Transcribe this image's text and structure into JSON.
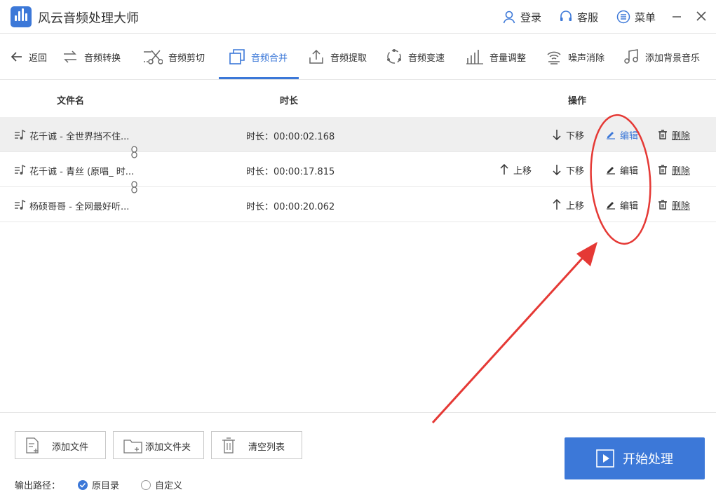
{
  "app": {
    "title": "风云音频处理大师"
  },
  "top_actions": {
    "login": "登录",
    "service": "客服",
    "menu": "菜单"
  },
  "nav": {
    "back": "返回",
    "items": [
      "音频转换",
      "音频剪切",
      "音频合并",
      "音频提取",
      "音频变速",
      "音量调整",
      "噪声消除",
      "添加背景音乐"
    ],
    "active": "音频合并"
  },
  "table": {
    "headers": {
      "filename": "文件名",
      "duration": "时长",
      "operation": "操作"
    },
    "rows": [
      {
        "name": "花千诚 - 全世界挡不住...",
        "duration": "时长：00:00:02.168",
        "up": "",
        "down": "下移",
        "edit": "编辑",
        "delete": "删除"
      },
      {
        "name": "花千诚 - 青丝 (原唱_ 时...",
        "duration": "时长：00:00:17.815",
        "up": "上移",
        "down": "下移",
        "edit": "编辑",
        "delete": "删除"
      },
      {
        "name": "杨硕哥哥 - 全网最好听...",
        "duration": "时长：00:00:20.062",
        "up": "上移",
        "down": "",
        "edit": "编辑",
        "delete": "删除"
      }
    ]
  },
  "bottom": {
    "add_file": "添加文件",
    "add_folder": "添加文件夹",
    "clear_list": "清空列表",
    "start": "开始处理",
    "output_label": "输出路径：",
    "radio_original": "原目录",
    "radio_custom": "自定义"
  },
  "colors": {
    "accent": "#3c78d8",
    "annotation": "#e53935"
  }
}
